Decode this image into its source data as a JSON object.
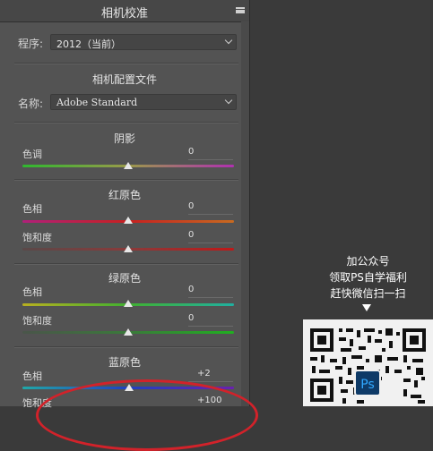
{
  "panel": {
    "title": "相机校准",
    "process_label": "程序:",
    "process_value": "2012（当前）",
    "profile_section": "相机配置文件",
    "name_label": "名称:",
    "name_value": "Adobe Standard"
  },
  "sections": {
    "shadow": {
      "title": "阴影",
      "tint_label": "色调",
      "tint_value": "0"
    },
    "red": {
      "title": "红原色",
      "hue_label": "色相",
      "hue_value": "0",
      "sat_label": "饱和度",
      "sat_value": "0"
    },
    "green": {
      "title": "绿原色",
      "hue_label": "色相",
      "hue_value": "0",
      "sat_label": "饱和度",
      "sat_value": "0"
    },
    "blue": {
      "title": "蓝原色",
      "hue_label": "色相",
      "hue_value": "+2",
      "sat_label": "饱和度",
      "sat_value": "+100"
    }
  },
  "promo": {
    "line1": "加公众号",
    "line2": "领取PS自学福利",
    "line3": "赶快微信扫一扫",
    "badge": "Ps"
  },
  "colors": {
    "annotation_circle": "#d2222a",
    "panel_bg": "#535353",
    "page_bg": "#3a3a3a"
  }
}
